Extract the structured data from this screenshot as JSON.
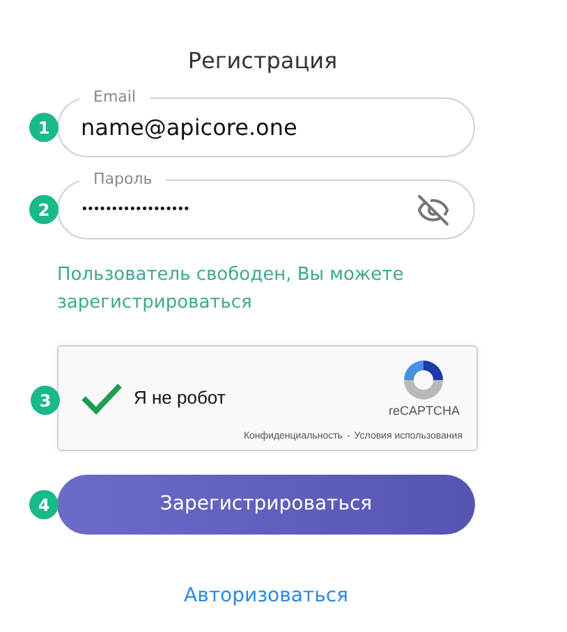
{
  "title": "Регистрация",
  "fields": [
    {
      "step": "1",
      "label": "Email",
      "value": "name@apicore.one",
      "kind": "text"
    },
    {
      "step": "2",
      "label": "Пароль",
      "value": "••••••••••••••••••",
      "kind": "password"
    }
  ],
  "message": "Пользователь свободен, Вы можете зарегистрироваться",
  "captcha": {
    "step": "3",
    "label": "Я не робот",
    "checked": true,
    "brand": "reCAPTCHA",
    "privacy": "Конфиденциальность",
    "separator": "-",
    "terms": "Условия использования"
  },
  "submit": {
    "step": "4",
    "label": "Зарегистрироваться"
  },
  "login_link": "Авторизоваться"
}
